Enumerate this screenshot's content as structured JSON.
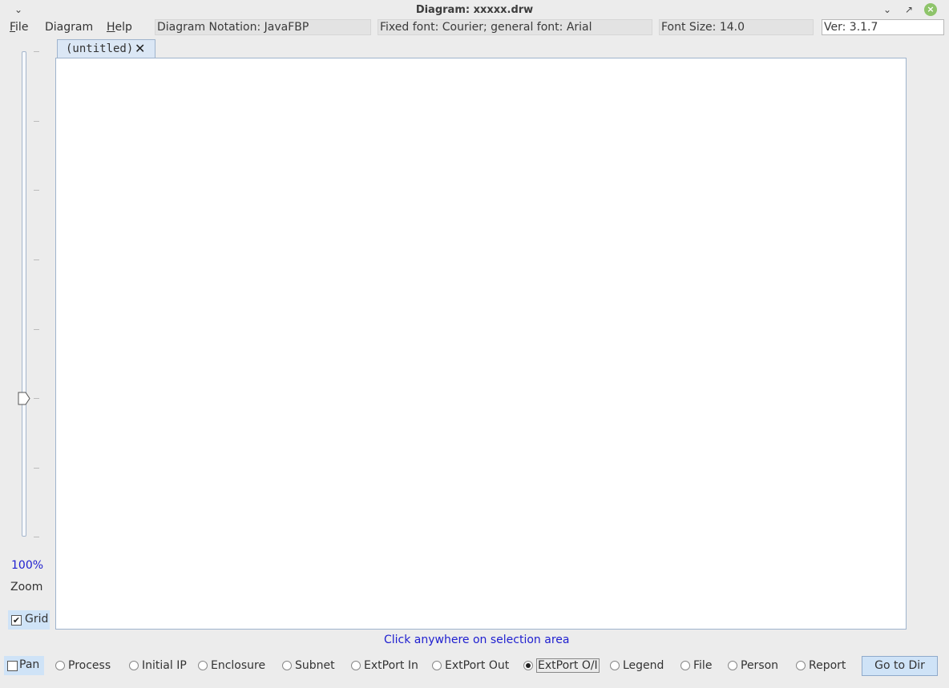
{
  "window": {
    "title": "Diagram: xxxxx.drw"
  },
  "menubar": {
    "file": "File",
    "diagram": "Diagram",
    "help": "Help"
  },
  "info": {
    "notation": "Diagram Notation: JavaFBP",
    "fonts": "Fixed font: Courier; general font: Arial",
    "font_size": "Font Size: 14.0",
    "version": "Ver: 3.1.7"
  },
  "zoom": {
    "value": "100%",
    "label": "Zoom",
    "level_percent": 100
  },
  "grid": {
    "label": "Grid",
    "checked": true
  },
  "tabs": [
    {
      "label": "(untitled)"
    }
  ],
  "status": {
    "hint": "Click anywhere on selection area"
  },
  "toolbar": {
    "pan": {
      "label": "Pan",
      "checked": false
    },
    "options": [
      {
        "label": "Process",
        "selected": false
      },
      {
        "label": "Initial IP",
        "selected": false
      },
      {
        "label": "Enclosure",
        "selected": false
      },
      {
        "label": "Subnet",
        "selected": false
      },
      {
        "label": "ExtPort In",
        "selected": false
      },
      {
        "label": "ExtPort Out",
        "selected": false
      },
      {
        "label": "ExtPort O/I",
        "selected": true
      },
      {
        "label": "Legend",
        "selected": false
      },
      {
        "label": "File",
        "selected": false
      },
      {
        "label": "Person",
        "selected": false
      },
      {
        "label": "Report",
        "selected": false
      }
    ],
    "goto_dir": "Go to Dir"
  }
}
